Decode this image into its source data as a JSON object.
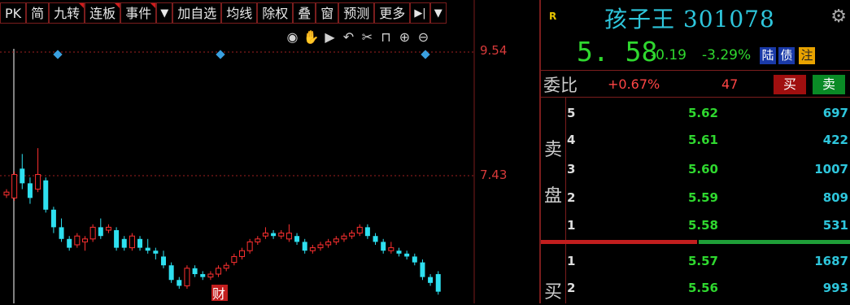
{
  "toolbar": {
    "items": [
      {
        "label": "PK",
        "flag": false
      },
      {
        "label": "简",
        "flag": false
      },
      {
        "label": "九转",
        "flag": true
      },
      {
        "label": "连板",
        "flag": true
      },
      {
        "label": "事件",
        "flag": true
      },
      {
        "label": "▼",
        "flag": false
      },
      {
        "label": "加自选",
        "flag": false
      },
      {
        "label": "均线",
        "flag": false
      },
      {
        "label": "除权",
        "flag": false
      },
      {
        "label": "叠",
        "flag": false
      },
      {
        "label": "窗",
        "flag": false
      },
      {
        "label": "预测",
        "flag": false
      },
      {
        "label": "更多",
        "flag": false
      },
      {
        "label": "▶|",
        "flag": false
      },
      {
        "label": "▼",
        "flag": false
      }
    ]
  },
  "chart_controls": [
    "eye-icon",
    "hand-icon",
    "play-icon",
    "undo-icon",
    "scissors-icon",
    "lock-icon",
    "zoom-in-icon",
    "zoom-out-icon"
  ],
  "chart": {
    "price_high_label": "9.54",
    "price_mid_label": "7.43",
    "finance_marker": "财",
    "up_color": "#ff3030",
    "down_color": "#2ee0f0"
  },
  "chart_data": {
    "type": "candlestick",
    "y_labels": [
      9.54,
      7.43
    ],
    "candles": [
      {
        "o": 7.1,
        "c": 7.15,
        "h": 7.2,
        "l": 7.05,
        "up": true
      },
      {
        "o": 7.05,
        "c": 7.45,
        "h": 7.5,
        "l": 7.0,
        "up": true
      },
      {
        "o": 7.55,
        "c": 7.3,
        "h": 7.8,
        "l": 7.2,
        "up": false
      },
      {
        "o": 7.3,
        "c": 7.05,
        "h": 7.4,
        "l": 6.95,
        "up": false
      },
      {
        "o": 7.2,
        "c": 7.45,
        "h": 7.9,
        "l": 7.15,
        "up": true
      },
      {
        "o": 7.35,
        "c": 6.85,
        "h": 7.4,
        "l": 6.8,
        "up": false
      },
      {
        "o": 6.85,
        "c": 6.55,
        "h": 6.9,
        "l": 6.45,
        "up": false
      },
      {
        "o": 6.55,
        "c": 6.35,
        "h": 6.7,
        "l": 6.3,
        "up": false
      },
      {
        "o": 6.35,
        "c": 6.2,
        "h": 6.4,
        "l": 6.15,
        "up": false
      },
      {
        "o": 6.25,
        "c": 6.4,
        "h": 6.45,
        "l": 6.2,
        "up": true
      },
      {
        "o": 6.3,
        "c": 6.35,
        "h": 6.4,
        "l": 6.15,
        "up": true
      },
      {
        "o": 6.35,
        "c": 6.55,
        "h": 6.6,
        "l": 6.3,
        "up": true
      },
      {
        "o": 6.55,
        "c": 6.4,
        "h": 6.7,
        "l": 6.35,
        "up": false
      },
      {
        "o": 6.5,
        "c": 6.55,
        "h": 6.6,
        "l": 6.45,
        "up": true
      },
      {
        "o": 6.5,
        "c": 6.2,
        "h": 6.55,
        "l": 6.15,
        "up": false
      },
      {
        "o": 6.35,
        "c": 6.2,
        "h": 6.4,
        "l": 6.15,
        "up": false
      },
      {
        "o": 6.2,
        "c": 6.4,
        "h": 6.45,
        "l": 6.15,
        "up": true
      },
      {
        "o": 6.35,
        "c": 6.2,
        "h": 6.4,
        "l": 6.15,
        "up": false
      },
      {
        "o": 6.2,
        "c": 6.15,
        "h": 6.35,
        "l": 6.1,
        "up": false
      },
      {
        "o": 6.15,
        "c": 6.1,
        "h": 6.2,
        "l": 6.0,
        "up": false
      },
      {
        "o": 6.05,
        "c": 5.9,
        "h": 6.15,
        "l": 5.85,
        "up": false
      },
      {
        "o": 5.9,
        "c": 5.65,
        "h": 5.95,
        "l": 5.6,
        "up": false
      },
      {
        "o": 5.65,
        "c": 5.55,
        "h": 5.7,
        "l": 5.5,
        "up": false
      },
      {
        "o": 5.55,
        "c": 5.85,
        "h": 5.9,
        "l": 5.5,
        "up": true
      },
      {
        "o": 5.85,
        "c": 5.75,
        "h": 5.9,
        "l": 5.7,
        "up": false
      },
      {
        "o": 5.75,
        "c": 5.7,
        "h": 5.8,
        "l": 5.65,
        "up": false
      },
      {
        "o": 5.7,
        "c": 5.75,
        "h": 5.8,
        "l": 5.65,
        "up": true
      },
      {
        "o": 5.75,
        "c": 5.85,
        "h": 5.9,
        "l": 5.7,
        "up": true
      },
      {
        "o": 5.85,
        "c": 5.9,
        "h": 5.95,
        "l": 5.8,
        "up": true
      },
      {
        "o": 5.95,
        "c": 6.05,
        "h": 6.1,
        "l": 5.9,
        "up": true
      },
      {
        "o": 6.05,
        "c": 6.15,
        "h": 6.2,
        "l": 6.0,
        "up": true
      },
      {
        "o": 6.15,
        "c": 6.3,
        "h": 6.35,
        "l": 6.1,
        "up": true
      },
      {
        "o": 6.3,
        "c": 6.35,
        "h": 6.4,
        "l": 6.25,
        "up": true
      },
      {
        "o": 6.4,
        "c": 6.45,
        "h": 6.55,
        "l": 6.35,
        "up": true
      },
      {
        "o": 6.45,
        "c": 6.4,
        "h": 6.5,
        "l": 6.35,
        "up": false
      },
      {
        "o": 6.4,
        "c": 6.45,
        "h": 6.5,
        "l": 6.35,
        "up": true
      },
      {
        "o": 6.45,
        "c": 6.35,
        "h": 6.6,
        "l": 6.3,
        "up": true
      },
      {
        "o": 6.4,
        "c": 6.3,
        "h": 6.45,
        "l": 6.25,
        "up": false
      },
      {
        "o": 6.3,
        "c": 6.15,
        "h": 6.35,
        "l": 6.1,
        "up": false
      },
      {
        "o": 6.15,
        "c": 6.2,
        "h": 6.25,
        "l": 6.1,
        "up": true
      },
      {
        "o": 6.2,
        "c": 6.25,
        "h": 6.3,
        "l": 6.15,
        "up": true
      },
      {
        "o": 6.25,
        "c": 6.3,
        "h": 6.35,
        "l": 6.2,
        "up": true
      },
      {
        "o": 6.3,
        "c": 6.35,
        "h": 6.4,
        "l": 6.25,
        "up": true
      },
      {
        "o": 6.35,
        "c": 6.4,
        "h": 6.45,
        "l": 6.3,
        "up": true
      },
      {
        "o": 6.4,
        "c": 6.45,
        "h": 6.5,
        "l": 6.35,
        "up": true
      },
      {
        "o": 6.45,
        "c": 6.55,
        "h": 6.6,
        "l": 6.4,
        "up": true
      },
      {
        "o": 6.55,
        "c": 6.4,
        "h": 6.6,
        "l": 6.35,
        "up": false
      },
      {
        "o": 6.4,
        "c": 6.3,
        "h": 6.45,
        "l": 6.25,
        "up": false
      },
      {
        "o": 6.3,
        "c": 6.15,
        "h": 6.35,
        "l": 6.1,
        "up": false
      },
      {
        "o": 6.2,
        "c": 6.15,
        "h": 6.3,
        "l": 6.1,
        "up": true
      },
      {
        "o": 6.15,
        "c": 6.1,
        "h": 6.2,
        "l": 6.05,
        "up": false
      },
      {
        "o": 6.1,
        "c": 6.05,
        "h": 6.15,
        "l": 6.0,
        "up": false
      },
      {
        "o": 6.05,
        "c": 5.95,
        "h": 6.1,
        "l": 5.9,
        "up": false
      },
      {
        "o": 5.95,
        "c": 5.7,
        "h": 6.0,
        "l": 5.65,
        "up": false
      },
      {
        "o": 5.7,
        "c": 5.6,
        "h": 5.75,
        "l": 5.55,
        "up": false
      },
      {
        "o": 5.75,
        "c": 5.45,
        "h": 5.8,
        "l": 5.4,
        "up": false
      }
    ],
    "candle_count": 56
  },
  "quote": {
    "rating": "R",
    "name": "孩子王 301078",
    "last_price": "5. 58",
    "change": "-0.19",
    "change_pct": "-3.29%",
    "tag_lu": "陆",
    "tag_zhai": "债",
    "tag_zhu": "注",
    "weibi_label": "委比",
    "weibi_pct": "+0.67%",
    "weibi_num": "47",
    "buy_label": "买",
    "sell_label": "卖",
    "sell_side_label_1": "卖",
    "sell_side_label_2": "盘",
    "buy_side_label_1": "买",
    "asks": [
      {
        "level": "5",
        "price": "5.62",
        "vol": "697"
      },
      {
        "level": "4",
        "price": "5.61",
        "vol": "422"
      },
      {
        "level": "3",
        "price": "5.60",
        "vol": "1007"
      },
      {
        "level": "2",
        "price": "5.59",
        "vol": "809"
      },
      {
        "level": "1",
        "price": "5.58",
        "vol": "531"
      }
    ],
    "bids": [
      {
        "level": "1",
        "price": "5.57",
        "vol": "1687"
      },
      {
        "level": "2",
        "price": "5.56",
        "vol": "993"
      }
    ]
  }
}
